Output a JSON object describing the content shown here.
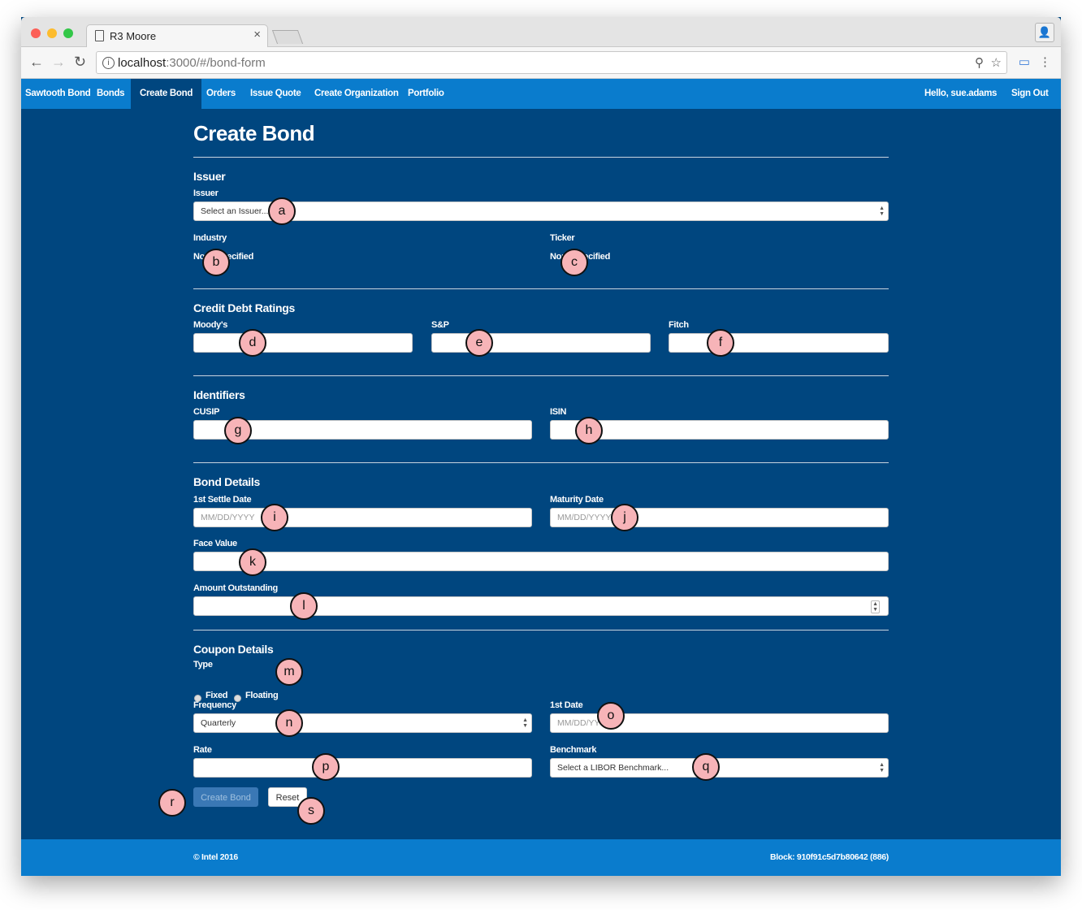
{
  "browser": {
    "tab_title": "R3 Moore",
    "tab_close": "×",
    "url_host": "localhost",
    "url_path": ":3000/#/bond-form",
    "back": "←",
    "forward": "→",
    "reload": "↻",
    "info": "i",
    "zoom": "⚲",
    "bookmark": "☆",
    "cast": "▭",
    "menu": "⋮",
    "profile": "👤"
  },
  "nav": {
    "brand": "Sawtooth Bond",
    "items": [
      "Bonds",
      "Create Bond",
      "Orders",
      "Issue Quote",
      "Create Organization",
      "Portfolio"
    ],
    "active_index": 1,
    "greeting": "Hello, sue.adams",
    "sign_out": "Sign Out"
  },
  "form": {
    "title": "Create Bond",
    "issuer_section": {
      "title": "Issuer",
      "issuer_label": "Issuer",
      "issuer_value": "Select an Issuer...",
      "industry_label": "Industry",
      "industry_value": "None specified",
      "ticker_label": "Ticker",
      "ticker_value": "None specified"
    },
    "ratings_section": {
      "title": "Credit Debt Ratings",
      "moodys_label": "Moody's",
      "sp_label": "S&P",
      "fitch_label": "Fitch"
    },
    "identifiers_section": {
      "title": "Identifiers",
      "cusip_label": "CUSIP",
      "isin_label": "ISIN"
    },
    "bond_details": {
      "title": "Bond Details",
      "settle_label": "1st Settle Date",
      "settle_placeholder": "MM/DD/YYYY",
      "maturity_label": "Maturity Date",
      "maturity_placeholder": "MM/DD/YYYY",
      "face_label": "Face Value",
      "amount_label": "Amount Outstanding"
    },
    "coupon_details": {
      "title": "Coupon Details",
      "type_label": "Type",
      "type_options": [
        "Fixed",
        "Floating"
      ],
      "frequency_label": "Frequency",
      "frequency_value": "Quarterly",
      "first_date_label": "1st Date",
      "first_date_placeholder": "MM/DD/YYYY",
      "rate_label": "Rate",
      "benchmark_label": "Benchmark",
      "benchmark_value": "Select a LIBOR Benchmark..."
    },
    "buttons": {
      "create": "Create Bond",
      "reset": "Reset"
    }
  },
  "footer": {
    "copyright": "© Intel 2016",
    "block": "Block: 910f91c5d7b80642 (886)"
  },
  "markers": [
    "a",
    "b",
    "c",
    "d",
    "e",
    "f",
    "g",
    "h",
    "i",
    "j",
    "k",
    "l",
    "m",
    "n",
    "o",
    "p",
    "q",
    "r",
    "s"
  ]
}
